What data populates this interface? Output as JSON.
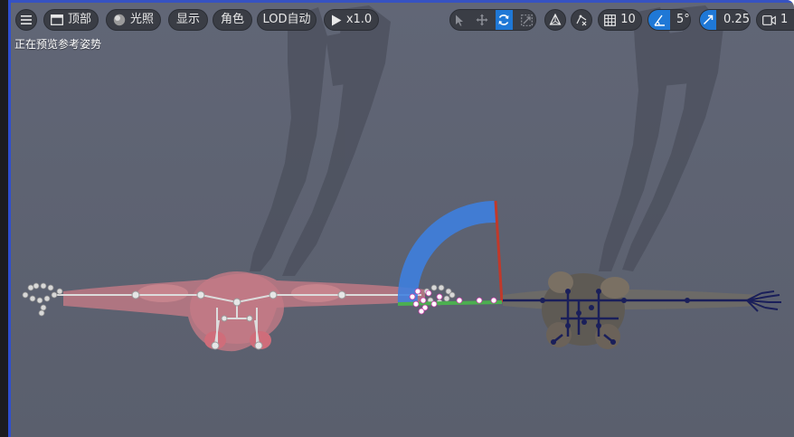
{
  "toolbar": {
    "menu_icon": "hamburger-menu-icon",
    "view_label": "顶部",
    "lighting_label": "光照",
    "show_label": "显示",
    "character_label": "角色",
    "lod_label": "LOD自动",
    "play_speed_label": "x1.0",
    "grid_snap_value": "10",
    "rotation_snap_value": "5°",
    "scale_snap_value": "0.25",
    "camera_speed_value": "1",
    "active_transform_tool": "rotate"
  },
  "status": {
    "preview_text": "正在预览参考姿势"
  },
  "colors": {
    "viewport_bg": "#5f6473",
    "accent": "#1f78d6",
    "gizmo_arc": "#3d7fe0",
    "gizmo_x": "#c0392b",
    "gizmo_y": "#4caf50",
    "ghost_mesh": "#c47b86",
    "skeleton_dark": "#1a1f5a"
  }
}
